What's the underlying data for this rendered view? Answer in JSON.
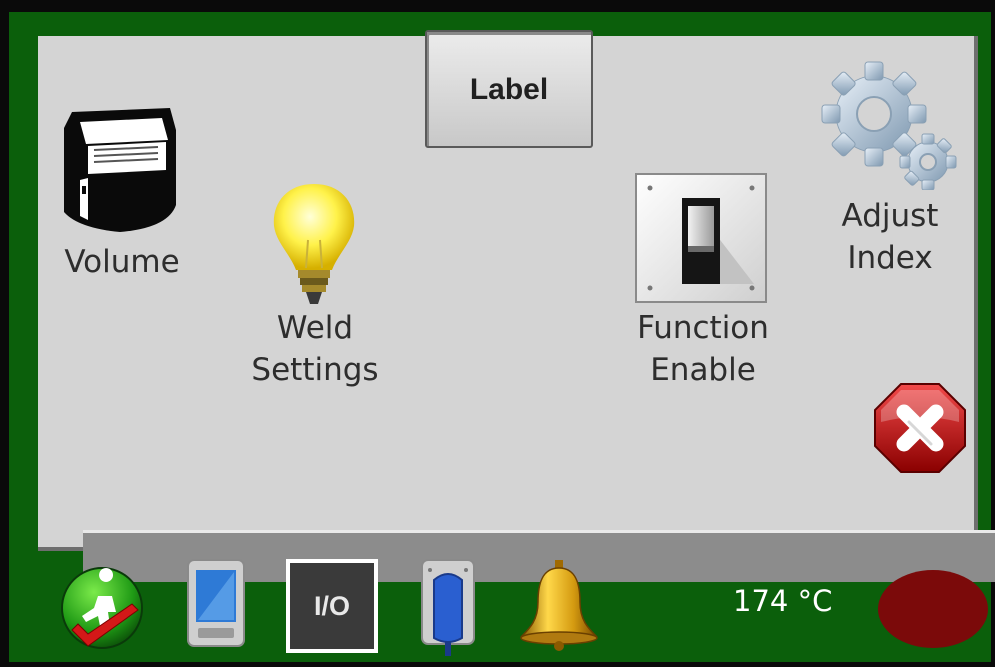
{
  "header": {
    "label_button": "Label"
  },
  "menu": {
    "volume": "Volume",
    "weld_line1": "Weld",
    "weld_line2": "Settings",
    "function_line1": "Function",
    "function_line2": "Enable",
    "adjust_line1": "Adjust",
    "adjust_line2": "Index"
  },
  "bottom_bar": {
    "io_label": "I/O",
    "temperature": "174 °C"
  },
  "icons": {
    "volume": "printer-icon",
    "weld": "light-bulb-icon",
    "function": "toggle-switch-icon",
    "adjust": "gears-icon",
    "close": "close-icon",
    "run": "run-check-icon",
    "device": "handheld-device-icon",
    "sensor": "sensor-icon",
    "alarm": "bell-icon"
  },
  "colors": {
    "frame_green": "#0b5f0b",
    "panel_gray": "#d4d4d4",
    "alarm_indicator": "#7b0a0a"
  }
}
